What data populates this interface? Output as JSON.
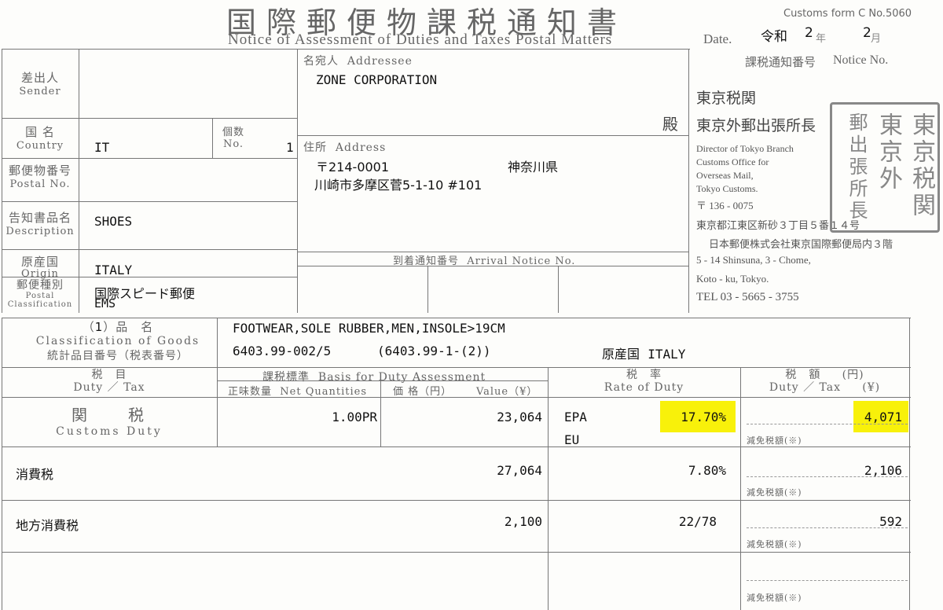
{
  "header": {
    "title_jp": "国際郵便物課税通知書",
    "title_en": "Notice of Assessment of Duties and Taxes Postal Matters",
    "form_no": "Customs form C No.5060",
    "date_label": "Date.",
    "date_era": "令和",
    "date_year": "2",
    "date_year_unit": "年",
    "date_month": "2",
    "date_month_unit": "月",
    "notice_no_label": "課税通知番号",
    "notice_no_label_en": "Notice No."
  },
  "sender": {
    "label_jp": "差出人",
    "label_en": "Sender",
    "value": ""
  },
  "country": {
    "label_jp": "国 名",
    "label_en": "Country",
    "value": "IT"
  },
  "pieces": {
    "label_jp": "個数",
    "label_en": "No.",
    "value": "1"
  },
  "postal_no": {
    "label_jp": "郵便物番号",
    "label_en": "Postal No.",
    "value": ""
  },
  "description": {
    "label_jp": "告知書品名",
    "label_en": "Description",
    "value": "SHOES"
  },
  "origin": {
    "label_jp": "原産国",
    "label_en": "Origin",
    "value": "ITALY"
  },
  "postal_class": {
    "label_jp": "郵便種別",
    "label_en": "Postal Classification",
    "value_jp": "国際スピード郵便",
    "value_en": "EMS"
  },
  "addressee": {
    "label_jp": "名宛人",
    "label_en": "Addressee",
    "name": "ZONE CORPORATION",
    "honorific": "殿",
    "address_label_jp": "住所",
    "address_label_en": "Address",
    "postcode": "〒214-0001",
    "prefecture": "神奈川県",
    "address_line": "川崎市多摩区菅5-1-10 #101"
  },
  "arrival_notice": {
    "label_jp": "到着通知番号",
    "label_en": "Arrival Notice No."
  },
  "office": {
    "name1": "東京税関",
    "name2": "東京外郵出張所長",
    "en_lines": [
      "Director of Tokyo Branch",
      "Customs Office for",
      "Overseas Mail,",
      "Tokyo Customs."
    ],
    "postcode": "〒 136 - 0075",
    "addr_jp1": "東京都江東区新砂３丁目５番１４号",
    "addr_jp2": "日本郵便株式会社東京国際郵便局内３階",
    "addr_en1": "5 - 14 Shinsuna, 3 - Chome,",
    "addr_en2": "Koto - ku, Tokyo.",
    "tel": "TEL 03 - 5665 - 3755",
    "seal_text": [
      "東京",
      "税関",
      "東京外",
      "郵出張",
      "所長"
    ]
  },
  "goods": {
    "item_no": "1",
    "label_jp1": "品　名",
    "label_en": "Classification of Goods",
    "label_jp2": "統計品目番号（税表番号）",
    "description": "FOOTWEAR,SOLE RUBBER,MEN,INSOLE>19CM",
    "code1": "6403.99-002/5",
    "code2": "(6403.99-1-(2))",
    "origin_label": "原産国",
    "origin_value": "ITALY"
  },
  "columns": {
    "duty_jp": "税　目",
    "duty_en": "Duty ／ Tax",
    "basis_jp": "課税標準",
    "basis_en": "Basis for Duty Assessment",
    "qty_jp": "正味数量",
    "qty_en": "Net Quantities",
    "value_jp": "価 格（円）",
    "value_en": "Value（¥）",
    "rate_jp": "税　率",
    "rate_en": "Rate of Duty",
    "amount_jp": "税　額",
    "amount_unit_jp": "(円)",
    "amount_en": "Duty ／ Tax",
    "amount_unit_en": "(¥)",
    "reduction_label": "減免税額(※)"
  },
  "rows": [
    {
      "tax_jp": "関　　税",
      "tax_en": "Customs Duty",
      "qty": "1.00PR",
      "value": "23,064",
      "rate_prefix1": "EPA",
      "rate_prefix2": "EU",
      "rate": "17.70%",
      "amount": "4,071"
    },
    {
      "tax_jp": "消費税",
      "tax_en": "",
      "qty": "",
      "value": "27,064",
      "rate_prefix1": "",
      "rate_prefix2": "",
      "rate": "7.80%",
      "amount": "2,106"
    },
    {
      "tax_jp": "地方消費税",
      "tax_en": "",
      "qty": "",
      "value": "2,100",
      "rate_prefix1": "",
      "rate_prefix2": "",
      "rate": "22/78",
      "amount": "592"
    }
  ],
  "colors": {
    "highlight": "#f8f10a",
    "line": "#777777",
    "seal": "#888888"
  }
}
